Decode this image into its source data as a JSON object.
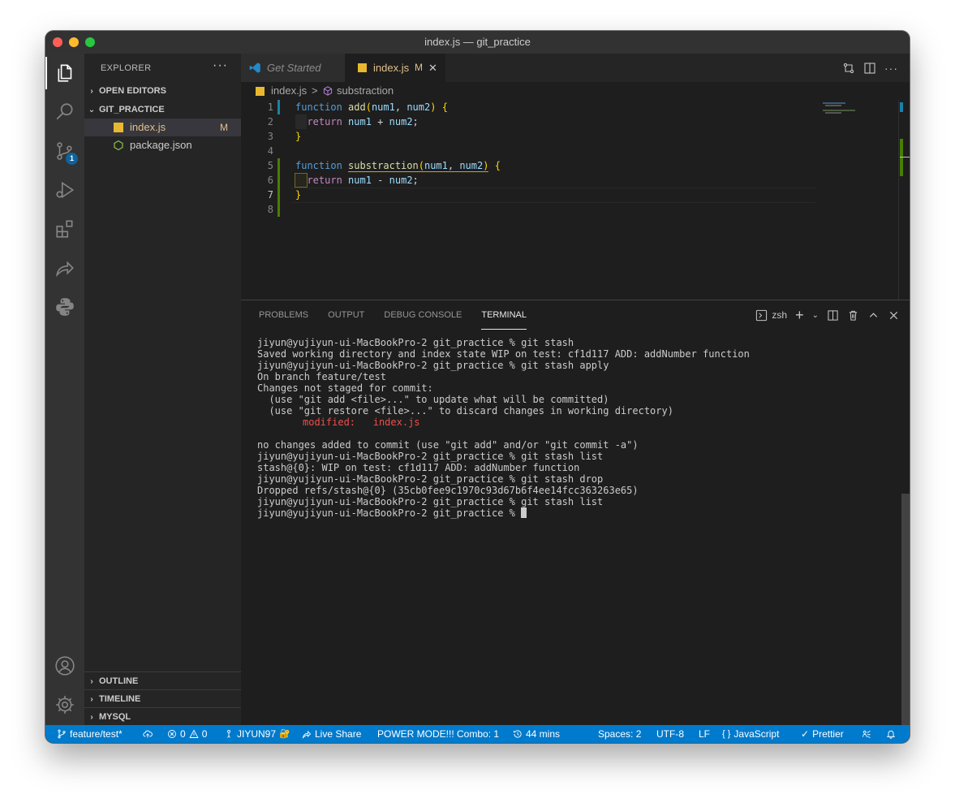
{
  "window": {
    "title": "index.js — git_practice"
  },
  "colors": {
    "statusbar": "#007acc",
    "modified": "#e2c08d",
    "keyword": "#569cd6",
    "function": "#dcdcaa",
    "param": "#9cdcfe",
    "error_red": "#f14c4c"
  },
  "activity_bar": {
    "items": [
      "files-icon",
      "search-icon",
      "source-control-icon",
      "run-debug-icon",
      "extensions-icon",
      "live-share-icon",
      "python-icon"
    ],
    "source_control_badge": "1",
    "bottom": [
      "account-icon",
      "settings-gear-icon"
    ]
  },
  "sidebar": {
    "title": "EXPLORER",
    "more": "···",
    "open_editors": "OPEN EDITORS",
    "project": "GIT_PRACTICE",
    "files": [
      {
        "name": "index.js",
        "status": "M",
        "icon": "js-file-icon"
      },
      {
        "name": "package.json",
        "status": "",
        "icon": "npm-file-icon"
      }
    ],
    "outline": "OUTLINE",
    "timeline": "TIMELINE",
    "mysql": "MYSQL"
  },
  "tabs": [
    {
      "label": "Get Started",
      "active": false,
      "icon": "vscode-icon"
    },
    {
      "label": "index.js",
      "status": "M",
      "active": true,
      "icon": "js-file-icon"
    }
  ],
  "breadcrumb": {
    "file": "index.js",
    "separator": ">",
    "symbol": "substraction"
  },
  "editor": {
    "line_numbers": [
      "1",
      "2",
      "3",
      "4",
      "5",
      "6",
      "7",
      "8"
    ],
    "current_line": "7",
    "code": {
      "l1_kw": "function",
      "l1_fn": "add",
      "l1_p1": "num1",
      "l1_p2": "num2",
      "l2_kw": "return",
      "l2_a": "num1",
      "l2_op": " + ",
      "l2_b": "num2",
      "l5_kw": "function",
      "l5_fn": "substraction",
      "l5_p1": "num1",
      "l5_p2": "num2",
      "l6_kw": "return",
      "l6_a": "num1",
      "l6_op": " - ",
      "l6_b": "num2"
    }
  },
  "panel": {
    "tabs": [
      "PROBLEMS",
      "OUTPUT",
      "DEBUG CONSOLE",
      "TERMINAL"
    ],
    "active_tab": "TERMINAL",
    "shell": "zsh",
    "terminal_lines": [
      "jiyun@yujiyun-ui-MacBookPro-2 git_practice % git stash",
      "Saved working directory and index state WIP on test: cf1d117 ADD: addNumber function",
      "jiyun@yujiyun-ui-MacBookPro-2 git_practice % git stash apply",
      "On branch feature/test",
      "Changes not staged for commit:",
      "  (use \"git add <file>...\" to update what will be committed)",
      "  (use \"git restore <file>...\" to discard changes in working directory)",
      "",
      "",
      "no changes added to commit (use \"git add\" and/or \"git commit -a\")",
      "jiyun@yujiyun-ui-MacBookPro-2 git_practice % git stash list",
      "stash@{0}: WIP on test: cf1d117 ADD: addNumber function",
      "jiyun@yujiyun-ui-MacBookPro-2 git_practice % git stash drop",
      "Dropped refs/stash@{0} (35cb0fee9c1970c93d67b6f4ee14fcc363263e65)",
      "jiyun@yujiyun-ui-MacBookPro-2 git_practice % git stash list",
      "jiyun@yujiyun-ui-MacBookPro-2 git_practice % "
    ],
    "modified_label": "modified:",
    "modified_file": "index.js"
  },
  "statusbar": {
    "branch": "feature/test*",
    "errors": "0",
    "warnings": "0",
    "user": "JIYUN97",
    "live_share": "Live Share",
    "power_mode": "POWER MODE!!! Combo: 1",
    "time": "44 mins",
    "spaces": "Spaces: 2",
    "encoding": "UTF-8",
    "eol": "LF",
    "language": "JavaScript",
    "formatter": "Prettier"
  }
}
